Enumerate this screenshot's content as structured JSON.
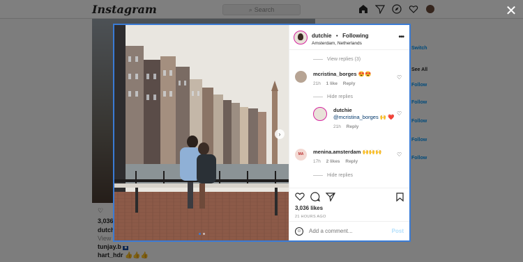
{
  "background": {
    "logo": "Instagram",
    "search_placeholder": "Search",
    "likes": "3,036",
    "user": "dutchie",
    "view_prefix": "View a",
    "comment1_user": "tunjay.b",
    "comment2_user": "hart_hdr",
    "comment2_text": "👍👍👍",
    "switch": "Switch",
    "see_all": "See All",
    "follow_labels": [
      "Follow",
      "Follow",
      "Follow",
      "Follow",
      "Follow"
    ]
  },
  "modal": {
    "header": {
      "username": "dutchie",
      "separator": "•",
      "follow_status": "Following",
      "location": "Amsterdam, Netherlands",
      "more": "•••"
    },
    "comments": {
      "view_replies_1": "View replies (3)",
      "c1": {
        "user": "mcristina_borges",
        "text": "😍😍",
        "time": "21h",
        "likes": "1 like",
        "reply": "Reply"
      },
      "hide_replies_1": "Hide replies",
      "r1": {
        "user": "dutchie",
        "mention": "@mcristina_borges",
        "text": "🙌 ❤️",
        "time": "21h",
        "reply": "Reply"
      },
      "c2": {
        "user": "menina.amsterdam",
        "avatar_text": "MA",
        "text": "🙌🙌🙌",
        "time": "17h",
        "likes": "2 likes",
        "reply": "Reply"
      },
      "hide_replies_2": "Hide replies"
    },
    "likes_count": "3,036 likes",
    "time_ago": "21 HOURS AGO",
    "add_comment_placeholder": "Add a comment...",
    "post_label": "Post"
  },
  "close_symbol": "✕"
}
